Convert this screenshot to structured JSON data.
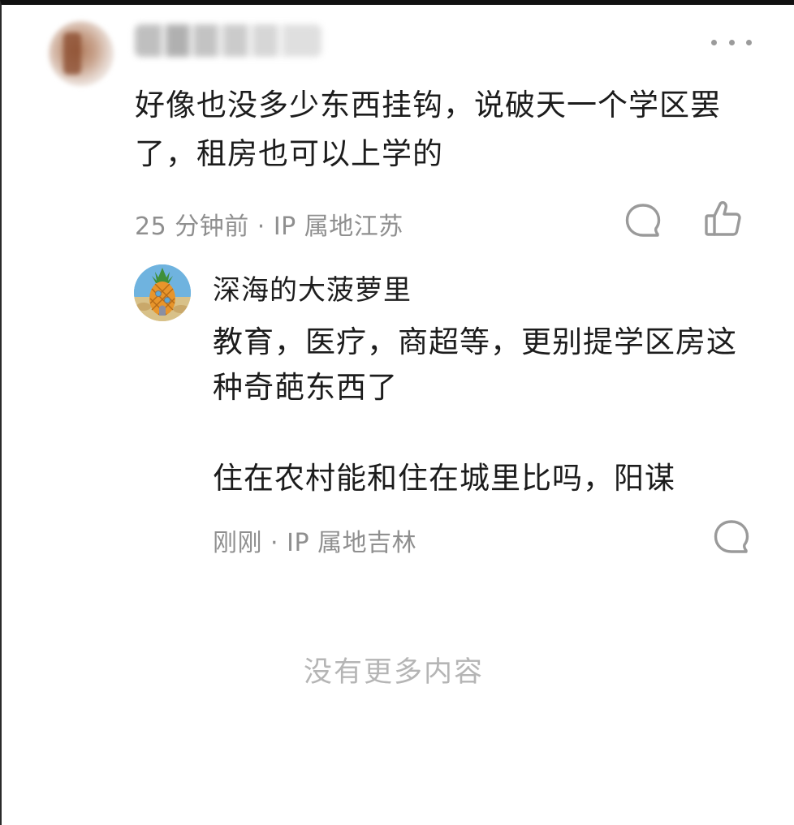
{
  "comment": {
    "text": "好像也没多少东西挂钩，说破天一个学区罢了，租房也可以上学的",
    "meta": "25 分钟前 · IP 属地江苏",
    "avatar_icon": "blurred-avatar",
    "more_icon": "more-dots-icon",
    "reply_icon": "comment-bubble-icon",
    "like_icon": "thumbs-up-icon"
  },
  "reply": {
    "author": "深海的大菠萝里",
    "text_line1": "教育，医疗，商超等，更别提学区房这种奇葩东西了",
    "text_line2": "住在农村能和住在城里比吗，阳谋",
    "meta": "刚刚 · IP 属地吉林",
    "avatar_icon": "pineapple-house-avatar",
    "reply_icon": "comment-bubble-icon"
  },
  "footer": {
    "no_more": "没有更多内容"
  },
  "colors": {
    "text": "#1c1c1c",
    "meta": "#8f8f8f",
    "footer": "#b5b5b5",
    "icon": "#9a9a9a"
  }
}
